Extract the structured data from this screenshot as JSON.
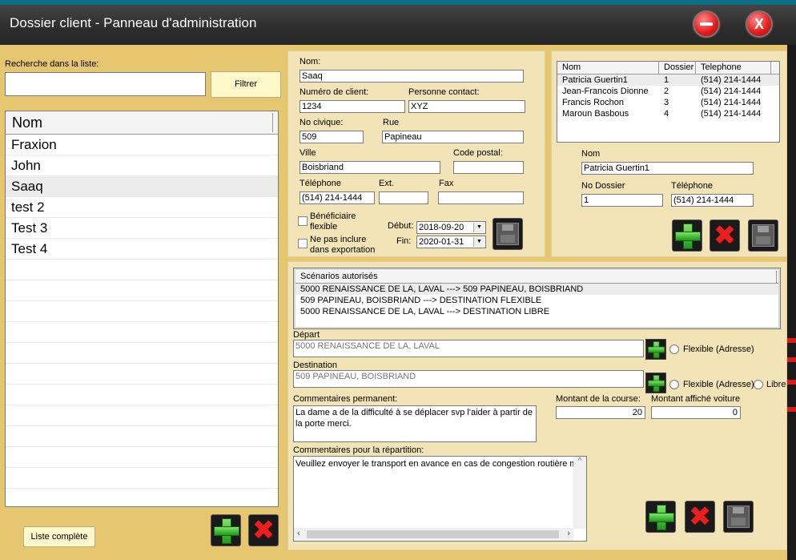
{
  "window": {
    "title": "Dossier client - Panneau d'administration"
  },
  "search": {
    "label": "Recherche dans la liste:",
    "value": "",
    "filter_label": "Filtrer"
  },
  "client_list": {
    "header": "Nom",
    "items": [
      "Fraxion",
      "John",
      "Saaq",
      "test 2",
      "Test 3",
      "Test 4"
    ],
    "selected": "Saaq",
    "full_list_label": "Liste complète"
  },
  "form": {
    "nom_label": "Nom:",
    "nom": "Saaq",
    "numero_label": "Numéro de client:",
    "numero": "1234",
    "contact_label": "Personne contact:",
    "contact": "XYZ",
    "civique_label": "No civique:",
    "civique": "509",
    "rue_label": "Rue",
    "rue": "Papineau",
    "ville_label": "Ville",
    "ville": "Boisbriand",
    "postal_label": "Code postal:",
    "postal": "",
    "tel_label": "Téléphone",
    "tel": "(514) 214-1444",
    "ext_label": "Ext.",
    "ext": "",
    "fax_label": "Fax",
    "fax": "",
    "flex_label": "Bénéficiaire flexible",
    "export_label": "Ne pas inclure dans exportation",
    "debut_label": "Début:",
    "debut": "2018-09-20",
    "fin_label": "Fin:",
    "fin": "2020-01-31"
  },
  "contacts": {
    "headers": [
      "Nom",
      "Dossier",
      "Telephone"
    ],
    "rows": [
      [
        "Patricia Guertin1",
        "1",
        "(514) 214-1444"
      ],
      [
        "Jean-Francois Dionne",
        "2",
        "(514) 214-1444"
      ],
      [
        "Francis Rochon",
        "3",
        "(514) 214-1444"
      ],
      [
        "Maroun Basbous",
        "4",
        "(514) 214-1444"
      ]
    ],
    "nom_label": "Nom",
    "nom": "Patricia Guertin1",
    "dossier_label": "No Dossier",
    "dossier": "1",
    "tel_label": "Téléphone",
    "tel": "(514) 214-1444"
  },
  "scenarios": {
    "header": "Scénarios autorisés",
    "rows": [
      "5000 RENAISSANCE DE LA, LAVAL ---> 509 PAPINEAU, BOISBRIAND",
      "509 PAPINEAU, BOISBRIAND ---> DESTINATION FLEXIBLE",
      "5000 RENAISSANCE DE LA, LAVAL ---> DESTINATION LIBRE"
    ],
    "depart_label": "Départ",
    "depart": "5000 RENAISSANCE DE LA, LAVAL",
    "destination_label": "Destination",
    "destination": "509 PAPINEAU, BOISBRIAND",
    "flex_adresse_label": "Flexible (Adresse)",
    "libre_label": "Libre",
    "comm_perm_label": "Commentaires permanent:",
    "comm_perm": "La dame a de la difficulté à se déplacer svp l'aider à partir de la porte merci.",
    "montant_label": "Montant de la course:",
    "montant": "20",
    "montant_affiche_label": "Montant affiché voiture",
    "montant_affiche": "0",
    "comm_rep_label": "Commentaires pour la répartition:",
    "comm_rep": "Veuillez envoyer le transport en avance en cas de congestion routière me"
  }
}
